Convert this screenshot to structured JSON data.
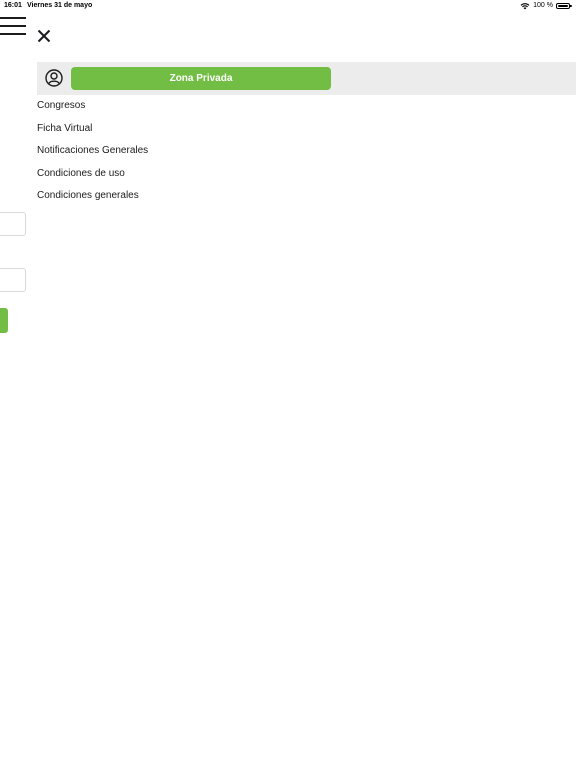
{
  "status_bar": {
    "time": "16:01",
    "date": "Viernes 31 de mayo",
    "battery": "100 %",
    "wifi_icon": "wifi-icon",
    "battery_icon": "battery-full-icon"
  },
  "background": {
    "menu_icon": "hamburger-icon"
  },
  "drawer": {
    "close_icon": "close-icon",
    "user_icon": "user-circle-icon",
    "private_button_label": "Zona Privada",
    "items": [
      {
        "label": "Congresos"
      },
      {
        "label": "Ficha Virtual"
      },
      {
        "label": "Notificaciones Generales"
      },
      {
        "label": "Condiciones de uso"
      },
      {
        "label": "Condiciones generales"
      }
    ]
  },
  "colors": {
    "accent_green": "#72be44",
    "bar_gray": "#ececec",
    "text": "#1c1c1e"
  }
}
